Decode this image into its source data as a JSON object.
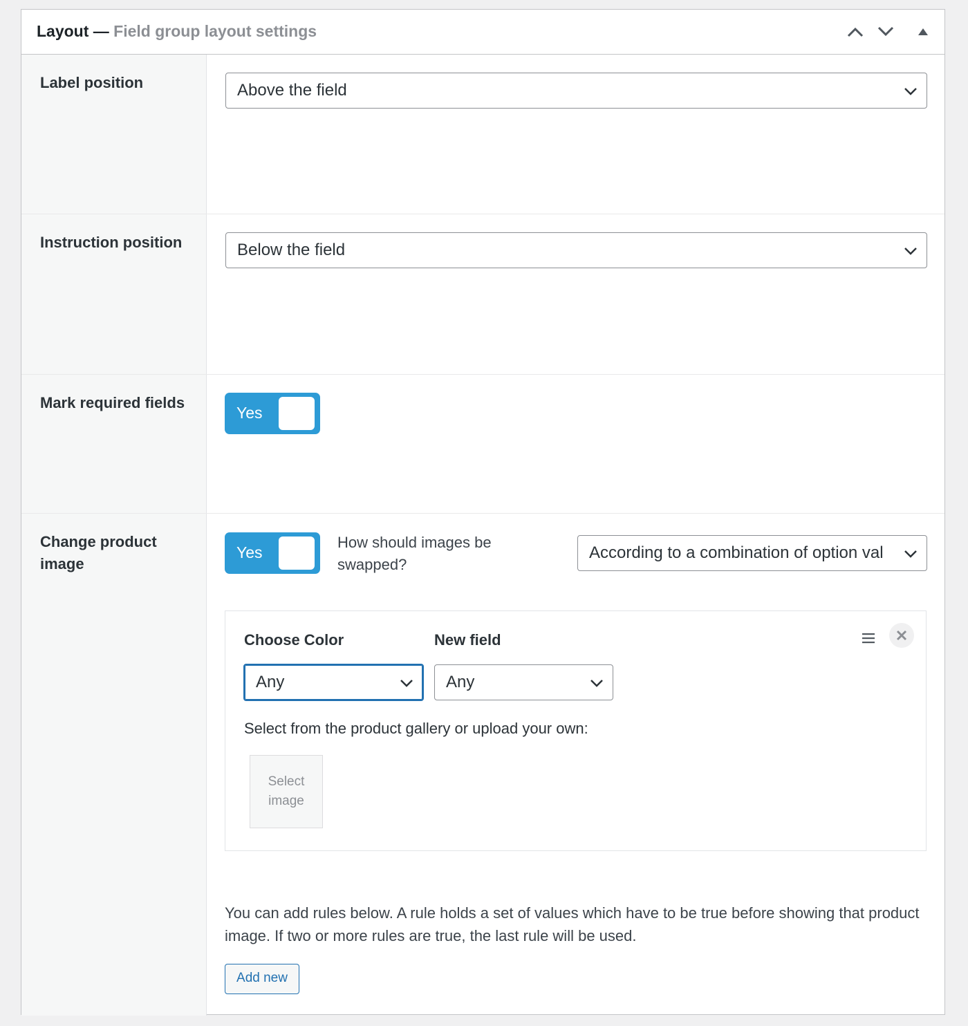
{
  "panel": {
    "title": "Layout",
    "separator": " — ",
    "subtitle": "Field group layout settings"
  },
  "rows": {
    "label_position": {
      "label": "Label position",
      "value": "Above the field"
    },
    "instruction_position": {
      "label": "Instruction position",
      "value": "Below the field"
    },
    "mark_required": {
      "label": "Mark required fields",
      "toggle_label": "Yes",
      "enabled": true
    },
    "change_image": {
      "label": "Change product image",
      "toggle_label": "Yes",
      "enabled": true,
      "question": "How should images be swapped?",
      "swap_value": "According to a combination of option val"
    }
  },
  "rule": {
    "col1_label": "Choose Color",
    "col2_label": "New field",
    "col1_value": "Any",
    "col2_value": "Any",
    "gallery_text": "Select from the product gallery or upload your own:",
    "image_slot": "Select image"
  },
  "help_text": "You can add rules below. A rule holds a set of values which have to be true before showing that product image. If two or more rules are true, the last rule will be used.",
  "add_button": "Add new",
  "colors": {
    "accent": "#2271b1",
    "toggle": "#2d9bd6"
  },
  "icons": {
    "move_up": "chevron-up-icon",
    "move_down": "chevron-down-icon",
    "collapse": "triangle-up-icon",
    "rule_menu": "hamburger-menu-icon",
    "rule_remove": "close-icon"
  }
}
